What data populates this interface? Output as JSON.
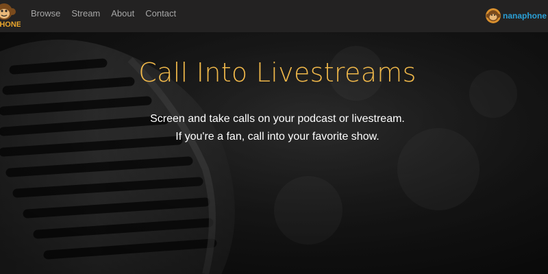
{
  "brand": {
    "logo_text": "PHONE",
    "logo_icon": "monkey-logo-icon",
    "color": "#e8a52c"
  },
  "nav": {
    "links": [
      {
        "label": "Browse"
      },
      {
        "label": "Stream"
      },
      {
        "label": "About"
      },
      {
        "label": "Contact"
      }
    ]
  },
  "user": {
    "name": "nanaphone",
    "avatar_icon": "monkey-avatar-icon",
    "color": "#2a9fd6"
  },
  "hero": {
    "title": "Call Into Livestreams",
    "subtitle_line1": "Screen and take calls on your podcast or livestream.",
    "subtitle_line2": "If you're a fan, call into your favorite show.",
    "background_icon": "microphone-icon",
    "title_color": "#f0b84a"
  }
}
